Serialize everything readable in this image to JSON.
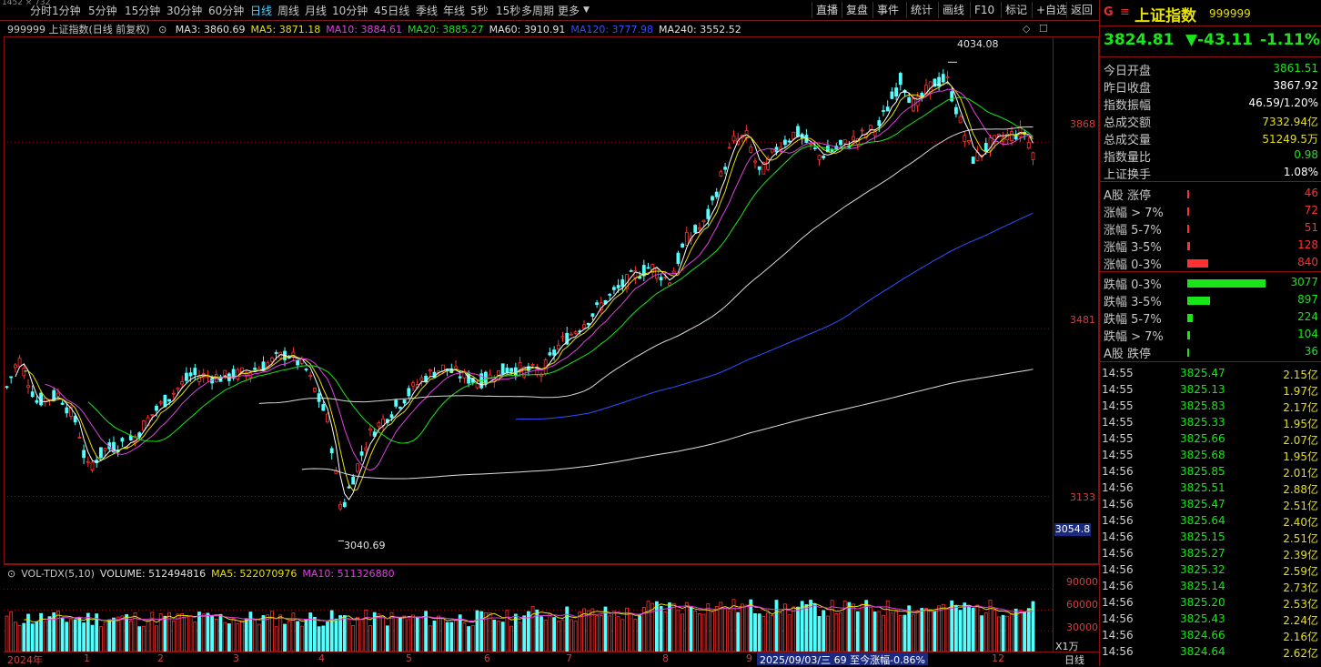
{
  "toolbar": {
    "periods": [
      "分时",
      "1分钟",
      "5分钟",
      "15分钟",
      "30分钟",
      "60分钟",
      "日线",
      "周线",
      "月线",
      "10分钟",
      "45日线",
      "季线",
      "年线",
      "5秒",
      "15秒",
      "多周期",
      "更多"
    ],
    "active_period": "日线",
    "corner": "1452 × 732",
    "right_buttons": [
      "直播",
      "复盘",
      "事件",
      "统计",
      "画线",
      "F10",
      "标记",
      "+自选",
      "返回"
    ]
  },
  "ma_legend": {
    "title": "999999 上证指数(日线 前复权)",
    "items": [
      {
        "label": "MA3: 3860.69",
        "color": "#e0e0e0"
      },
      {
        "label": "MA5: 3871.18",
        "color": "#e8e000"
      },
      {
        "label": "MA10: 3884.61",
        "color": "#e040e0"
      },
      {
        "label": "MA20: 3885.27",
        "color": "#19e619"
      },
      {
        "label": "MA60: 3910.91",
        "color": "#e0e0e0"
      },
      {
        "label": "MA120: 3777.98",
        "color": "#3050ff"
      },
      {
        "label": "MA240: 3552.52",
        "color": "#e0e0e0"
      }
    ]
  },
  "price_axis": [
    "3868",
    "3481",
    "3133"
  ],
  "price_box": "3054.8",
  "annotations": {
    "high": "4034.08",
    "low": "3040.69"
  },
  "vol_legend": {
    "items": [
      {
        "label": "VOL-TDX(5,10)",
        "color": "#c8c8c8"
      },
      {
        "label": "VOLUME: 512494816",
        "color": "#e0e0e0"
      },
      {
        "label": "MA5: 522070976",
        "color": "#e8e000"
      },
      {
        "label": "MA10: 511326880",
        "color": "#e040e0"
      }
    ]
  },
  "vol_axis": [
    "90000",
    "60000",
    "30000"
  ],
  "vol_unit": "X1万",
  "x_axis": {
    "labels": [
      "2024年",
      "1",
      "2",
      "3",
      "4",
      "5",
      "6",
      "7",
      "8",
      "9",
      "12"
    ],
    "date_box": "2025/09/03/三 69 至今涨幅-0.86%",
    "period_tag": "日线"
  },
  "chart_data": {
    "type": "candlestick",
    "title": "999999 上证指数(日线 前复权)",
    "annotations": [
      {
        "label": "4034.08",
        "value": 4034.08
      },
      {
        "label": "3040.69",
        "value": 3040.69
      }
    ],
    "y_ticks": [
      3868,
      3481,
      3133
    ],
    "ylim": [
      3000,
      4080
    ],
    "ma_current": {
      "MA3": 3860.69,
      "MA5": 3871.18,
      "MA10": 3884.61,
      "MA20": 3885.27,
      "MA60": 3910.91,
      "MA120": 3777.98,
      "MA240": 3552.52
    },
    "close_path_keypoints": [
      [
        0,
        3350
      ],
      [
        15,
        3420
      ],
      [
        35,
        3330
      ],
      [
        60,
        3345
      ],
      [
        80,
        3280
      ],
      [
        90,
        3190
      ],
      [
        110,
        3230
      ],
      [
        140,
        3250
      ],
      [
        160,
        3300
      ],
      [
        175,
        3330
      ],
      [
        205,
        3385
      ],
      [
        240,
        3380
      ],
      [
        265,
        3390
      ],
      [
        290,
        3410
      ],
      [
        310,
        3430
      ],
      [
        330,
        3400
      ],
      [
        355,
        3290
      ],
      [
        370,
        3100
      ],
      [
        380,
        3160
      ],
      [
        400,
        3260
      ],
      [
        430,
        3320
      ],
      [
        460,
        3380
      ],
      [
        480,
        3400
      ],
      [
        520,
        3370
      ],
      [
        555,
        3400
      ],
      [
        590,
        3390
      ],
      [
        610,
        3450
      ],
      [
        640,
        3500
      ],
      [
        660,
        3540
      ],
      [
        690,
        3590
      ],
      [
        710,
        3610
      ],
      [
        730,
        3580
      ],
      [
        750,
        3670
      ],
      [
        770,
        3700
      ],
      [
        800,
        3870
      ],
      [
        815,
        3880
      ],
      [
        830,
        3800
      ],
      [
        850,
        3860
      ],
      [
        870,
        3890
      ],
      [
        895,
        3840
      ],
      [
        920,
        3860
      ],
      [
        940,
        3880
      ],
      [
        960,
        3900
      ],
      [
        985,
        4000
      ],
      [
        1000,
        3940
      ],
      [
        1020,
        3990
      ],
      [
        1035,
        4000
      ],
      [
        1050,
        3910
      ],
      [
        1065,
        3830
      ],
      [
        1080,
        3860
      ],
      [
        1100,
        3880
      ],
      [
        1120,
        3890
      ],
      [
        1135,
        3825
      ]
    ]
  },
  "quote": {
    "g": "G",
    "menu": "≡",
    "name": "上证指数",
    "code": "999999",
    "price": "3824.81",
    "change": "▼-43.11",
    "pct": "-1.11%"
  },
  "stats": [
    {
      "k": "今日开盘",
      "v": "3861.51",
      "color": "#19e619"
    },
    {
      "k": "昨日收盘",
      "v": "3867.92",
      "color": "#ffffff"
    },
    {
      "k": "指数振幅",
      "v": "46.59/1.20%",
      "color": "#ffffff"
    },
    {
      "k": "总成交额",
      "v": "7332.94亿",
      "color": "#e8e000"
    },
    {
      "k": "总成交量",
      "v": "51249.5万",
      "color": "#e8e000"
    },
    {
      "k": "指数量比",
      "v": "0.98",
      "color": "#19e619"
    },
    {
      "k": "上证换手",
      "v": "1.08%",
      "color": "#ffffff"
    }
  ],
  "up_stats": [
    {
      "k": "A股 涨停",
      "v": "46",
      "frac": 0.02
    },
    {
      "k": "涨幅 > 7%",
      "v": "72",
      "frac": 0.02
    },
    {
      "k": "涨幅 5-7%",
      "v": "51",
      "frac": 0.02
    },
    {
      "k": "涨幅 3-5%",
      "v": "128",
      "frac": 0.04
    },
    {
      "k": "涨幅 0-3%",
      "v": "840",
      "frac": 0.27
    }
  ],
  "down_stats": [
    {
      "k": "跌幅 0-3%",
      "v": "3077",
      "frac": 1.0
    },
    {
      "k": "跌幅 3-5%",
      "v": "897",
      "frac": 0.29
    },
    {
      "k": "跌幅 5-7%",
      "v": "224",
      "frac": 0.07
    },
    {
      "k": "跌幅 > 7%",
      "v": "104",
      "frac": 0.03
    },
    {
      "k": "A股 跌停",
      "v": "36",
      "frac": 0.01
    }
  ],
  "ticks": [
    [
      "14:55",
      "3825.47",
      "2.15亿"
    ],
    [
      "14:55",
      "3825.13",
      "1.97亿"
    ],
    [
      "14:55",
      "3825.83",
      "2.17亿"
    ],
    [
      "14:55",
      "3825.33",
      "1.95亿"
    ],
    [
      "14:55",
      "3825.66",
      "2.07亿"
    ],
    [
      "14:55",
      "3825.68",
      "1.95亿"
    ],
    [
      "14:56",
      "3825.85",
      "2.01亿"
    ],
    [
      "14:56",
      "3825.51",
      "2.88亿"
    ],
    [
      "14:56",
      "3825.47",
      "2.51亿"
    ],
    [
      "14:56",
      "3825.64",
      "2.40亿"
    ],
    [
      "14:56",
      "3825.15",
      "2.51亿"
    ],
    [
      "14:56",
      "3825.27",
      "2.39亿"
    ],
    [
      "14:56",
      "3825.32",
      "2.59亿"
    ],
    [
      "14:56",
      "3825.14",
      "2.73亿"
    ],
    [
      "14:56",
      "3825.20",
      "2.53亿"
    ],
    [
      "14:56",
      "3825.43",
      "2.24亿"
    ],
    [
      "14:56",
      "3824.66",
      "2.16亿"
    ],
    [
      "14:56",
      "3824.64",
      "2.62亿"
    ]
  ]
}
